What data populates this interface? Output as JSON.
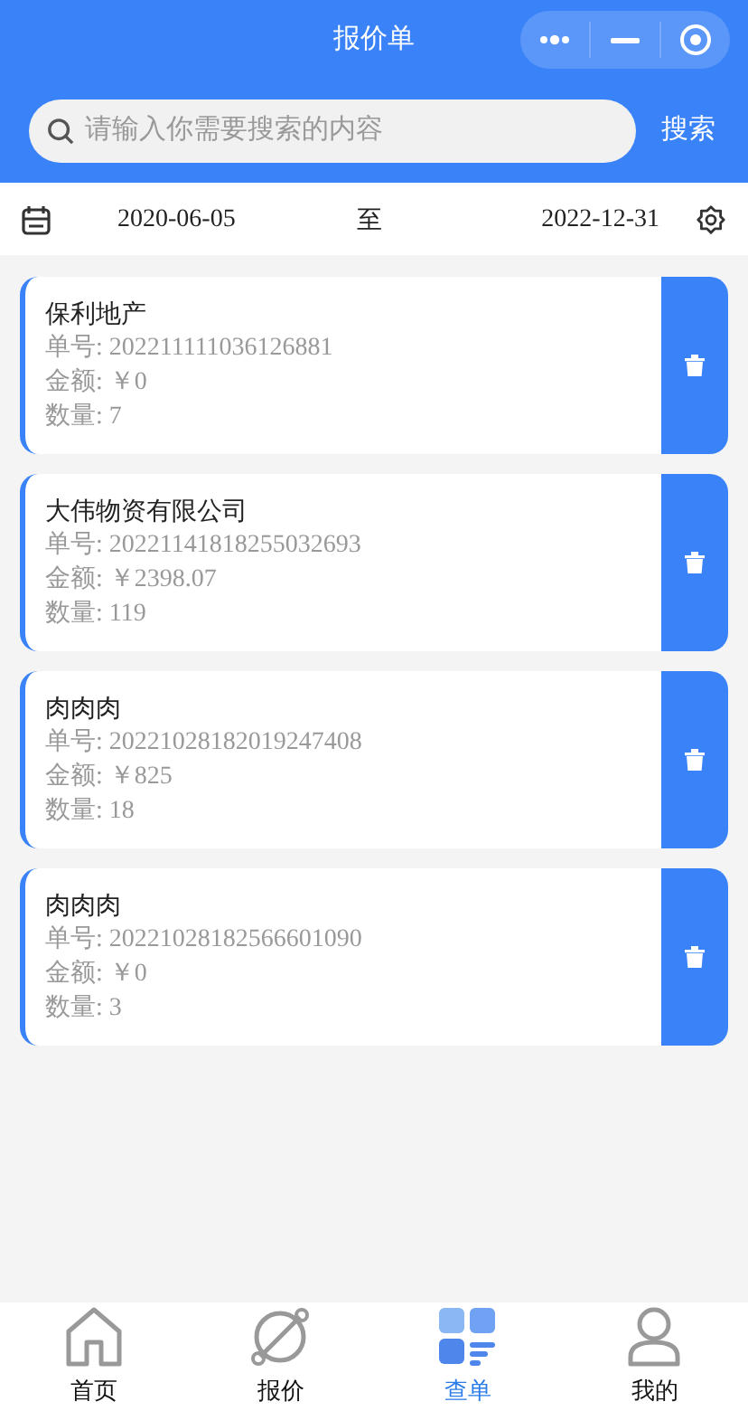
{
  "header": {
    "title": "报价单"
  },
  "search": {
    "placeholder": "请输入你需要搜索的内容",
    "button": "搜索"
  },
  "date_range": {
    "start": "2020-06-05",
    "separator": "至",
    "end": "2022-12-31"
  },
  "orders": [
    {
      "name": "保利地产",
      "number": "单号: 202211111036126881",
      "amount": "金额: ￥0",
      "quantity": "数量: 7"
    },
    {
      "name": "大伟物资有限公司",
      "number": "单号: 20221141818255032693",
      "amount": "金额: ￥2398.07",
      "quantity": "数量: 119"
    },
    {
      "name": "肉肉肉",
      "number": "单号: 20221028182019247408",
      "amount": "金额: ￥825",
      "quantity": "数量: 18"
    },
    {
      "name": "肉肉肉",
      "number": "单号: 20221028182566601090",
      "amount": "金额: ￥0",
      "quantity": "数量: 3"
    }
  ],
  "tab_bar": [
    {
      "kind": "home",
      "label": "首页",
      "selected": false
    },
    {
      "kind": "planet",
      "label": "报价",
      "selected": false
    },
    {
      "kind": "list",
      "label": "查单",
      "selected": true
    },
    {
      "kind": "user",
      "label": "我的",
      "selected": false
    }
  ]
}
